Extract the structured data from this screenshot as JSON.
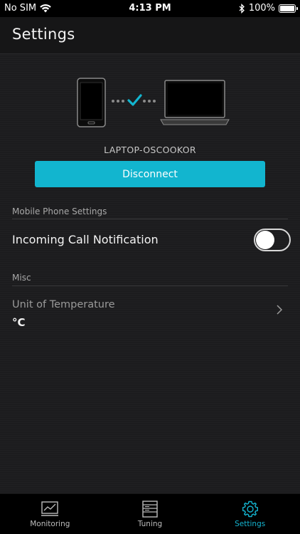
{
  "status_bar": {
    "carrier": "No SIM",
    "time": "4:13 PM",
    "battery_percent": "100%"
  },
  "header": {
    "title": "Settings"
  },
  "connection": {
    "device_name": "LAPTOP-OSCOOKOR",
    "disconnect_label": "Disconnect",
    "status_icon": "checkmark-icon"
  },
  "mobile_phone_settings": {
    "section_label": "Mobile Phone Settings",
    "incoming_call_label": "Incoming Call Notification",
    "incoming_call_enabled": false
  },
  "misc": {
    "section_label": "Misc",
    "unit_label": "Unit of Temperature",
    "unit_value": "°C"
  },
  "tabs": [
    {
      "label": "Monitoring",
      "icon": "chart-icon",
      "active": false
    },
    {
      "label": "Tuning",
      "icon": "server-icon",
      "active": false
    },
    {
      "label": "Settings",
      "icon": "gear-icon",
      "active": true
    }
  ],
  "colors": {
    "accent": "#12b5cf",
    "background": "#1c1c1e",
    "tabbar": "#000000"
  }
}
